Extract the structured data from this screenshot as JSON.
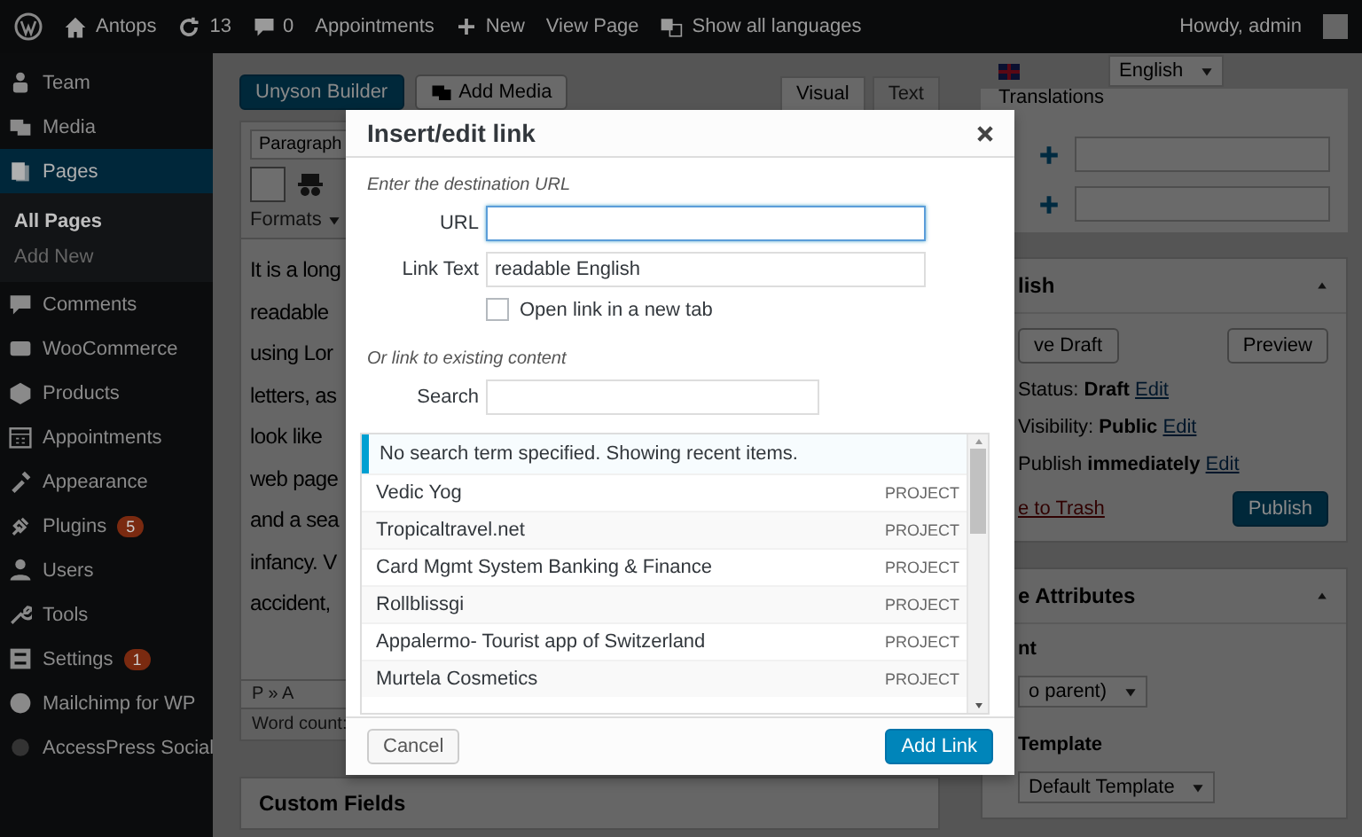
{
  "admin_bar": {
    "site": "Antops",
    "updates": "13",
    "comments": "0",
    "links": [
      {
        "label": "Appointments",
        "kind": "text"
      },
      {
        "label": "New",
        "kind": "plus"
      },
      {
        "label": "View Page",
        "kind": "text"
      },
      {
        "label": "Show all languages",
        "kind": "translate"
      }
    ],
    "greeting": "Howdy, admin"
  },
  "sidebar": {
    "items": [
      {
        "label": "Team",
        "selected": false
      },
      {
        "label": "Media",
        "selected": false
      },
      {
        "label": "Pages",
        "selected": true,
        "children": [
          {
            "label": "All Pages",
            "selected": true
          },
          {
            "label": "Add New",
            "selected": false
          }
        ]
      },
      {
        "label": "Comments",
        "selected": false
      },
      {
        "label": "WooCommerce",
        "selected": false
      },
      {
        "label": "Products",
        "selected": false
      },
      {
        "label": "Appointments",
        "selected": false
      },
      {
        "label": "Appearance",
        "selected": false
      },
      {
        "label": "Plugins",
        "selected": false,
        "badge": "5"
      },
      {
        "label": "Users",
        "selected": false
      },
      {
        "label": "Tools",
        "selected": false
      },
      {
        "label": "Settings",
        "selected": false,
        "badge": "1"
      },
      {
        "label": "Mailchimp for WP",
        "selected": false
      },
      {
        "label": "AccessPress Social",
        "selected": false
      }
    ]
  },
  "editor": {
    "builder_button": "Unyson Builder",
    "media_button": "Add Media",
    "tabs": [
      {
        "label": "Visual",
        "selected": true
      },
      {
        "label": "Text",
        "selected": false
      }
    ],
    "format_select": "Paragraph",
    "formats_menu": "Formats",
    "lines": [
      "It is a long",
      "readable",
      "using Lor",
      "letters, as",
      "look like",
      "web page",
      "and a sea",
      "infancy. V",
      "accident,"
    ],
    "path": "P » A",
    "word_count": "Word count:"
  },
  "custom_fields": {
    "title": "Custom Fields"
  },
  "language": {
    "value": "English",
    "translations_title": "Translations"
  },
  "publish": {
    "title": "lish",
    "save_button": "ve Draft",
    "preview_button": "Preview",
    "meta": [
      {
        "text": "Status: **Draft**",
        "link": "Edit"
      },
      {
        "text": "Visibility: **Public**",
        "link": "Edit"
      },
      {
        "text": "Publish **immediately**",
        "link": "Edit"
      }
    ],
    "trash_link": "e to Trash",
    "publish_button": "Publish"
  },
  "attributes": {
    "title": "e Attributes",
    "parent_label": "nt",
    "parent_value": "o parent)",
    "template_label": "Template",
    "template_value": "Default Template"
  },
  "dialog": {
    "title": "Insert/edit link",
    "url_hint": "Enter the destination URL",
    "url_label": "URL",
    "link_text_label": "Link Text",
    "link_text_value": "readable English",
    "new_tab": {
      "label": "Open link in a new tab",
      "checked": false
    },
    "existing_hint": "Or link to existing content",
    "search_label": "Search",
    "notice": "No search term specified. Showing recent items.",
    "results": [
      {
        "title": "Vedic Yog",
        "type": "PROJECT"
      },
      {
        "title": "Tropicaltravel.net",
        "type": "PROJECT"
      },
      {
        "title": "Card Mgmt System Banking & Finance",
        "type": "PROJECT"
      },
      {
        "title": "Rollblissgi",
        "type": "PROJECT"
      },
      {
        "title": "Appalermo- Tourist app of Switzerland",
        "type": "PROJECT"
      },
      {
        "title": "Murtela Cosmetics",
        "type": "PROJECT"
      }
    ],
    "cancel_button": "Cancel",
    "add_button": "Add Link"
  }
}
